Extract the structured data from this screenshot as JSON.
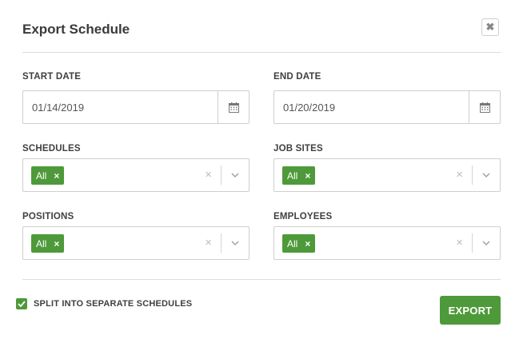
{
  "dialog": {
    "title": "Export Schedule",
    "close_glyph": "✖"
  },
  "start_date": {
    "label": "START DATE",
    "value": "01/14/2019",
    "icon": "calendar-icon"
  },
  "end_date": {
    "label": "END DATE",
    "value": "01/20/2019",
    "icon": "calendar-icon"
  },
  "schedules": {
    "label": "SCHEDULES",
    "tag": "All",
    "tag_remove": "×",
    "clear": "×"
  },
  "job_sites": {
    "label": "JOB SITES",
    "tag": "All",
    "tag_remove": "×",
    "clear": "×"
  },
  "positions": {
    "label": "POSITIONS",
    "tag": "All",
    "tag_remove": "×",
    "clear": "×"
  },
  "employees": {
    "label": "EMPLOYEES",
    "tag": "All",
    "tag_remove": "×",
    "clear": "×"
  },
  "split": {
    "label": "SPLIT INTO SEPARATE SCHEDULES",
    "checked": true
  },
  "export": {
    "label": "EXPORT"
  },
  "colors": {
    "accent": "#4e9a3a",
    "border": "#cfcfcf",
    "divider": "#dcdcdc"
  }
}
